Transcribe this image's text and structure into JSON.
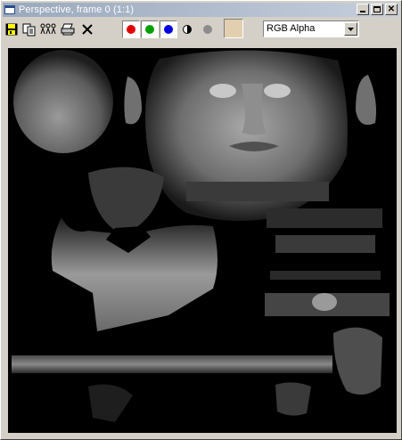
{
  "window": {
    "title": "Perspective, frame 0 (1:1)"
  },
  "toolbar": {
    "tools": [
      {
        "name": "save-icon"
      },
      {
        "name": "copy-icon"
      },
      {
        "name": "clone-icon"
      },
      {
        "name": "print-icon"
      },
      {
        "name": "clear-icon"
      }
    ],
    "channels": [
      {
        "name": "red-channel",
        "color": "#e00000"
      },
      {
        "name": "green-channel",
        "color": "#00a000"
      },
      {
        "name": "blue-channel",
        "color": "#0000e0"
      }
    ],
    "swatch_color": "#e1cfb0",
    "channel_select": {
      "value": "RGB Alpha"
    }
  },
  "viewport": {
    "description_icon": "texture-map-render"
  }
}
